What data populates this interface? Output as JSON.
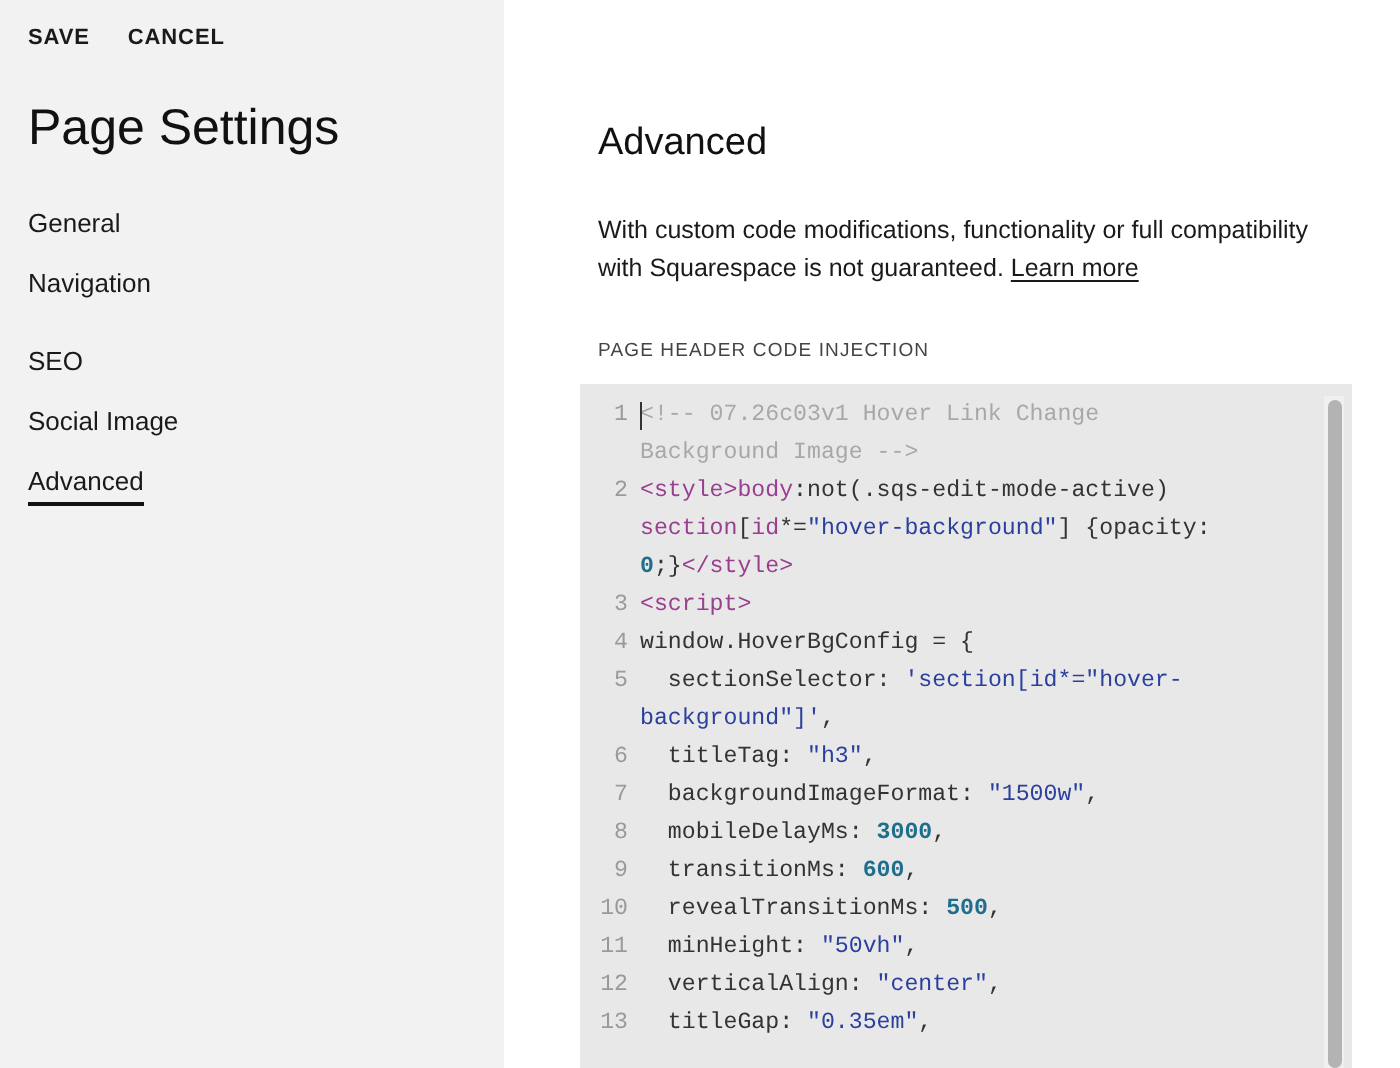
{
  "toolbar": {
    "buttons": [
      "SAVE",
      "CANCEL"
    ]
  },
  "sidebar": {
    "title": "Page Settings",
    "groups": [
      {
        "items": [
          {
            "label": "General",
            "selected": false
          },
          {
            "label": "Navigation",
            "selected": false
          }
        ]
      },
      {
        "items": [
          {
            "label": "SEO",
            "selected": false
          },
          {
            "label": "Social Image",
            "selected": false
          },
          {
            "label": "Advanced",
            "selected": true
          }
        ]
      }
    ]
  },
  "main": {
    "heading": "Advanced",
    "description": "With custom code modifications, functionality or full compatibility with Squarespace is not guaranteed.",
    "link": "Learn more",
    "section_label": "PAGE HEADER CODE INJECTION",
    "code_cursor": true,
    "code_lines": [
      {
        "number": "1",
        "rows": [
          {
            "tokens": [
              {
                "kind": "comment",
                "text": "<!-- 07.26c03v1 Hover Link Change"
              }
            ]
          },
          {
            "tokens": [
              {
                "kind": "comment",
                "text": "Background Image -->"
              }
            ]
          }
        ]
      },
      {
        "number": "2",
        "rows": [
          {
            "tokens": [
              {
                "kind": "tag",
                "text": "<style>"
              },
              {
                "kind": "tag",
                "text": "body"
              },
              {
                "kind": "plain",
                "text": ":not(.sqs-edit-mode-active)"
              }
            ]
          },
          {
            "tokens": [
              {
                "kind": "tag",
                "text": "section"
              },
              {
                "kind": "plain",
                "text": "["
              },
              {
                "kind": "tag",
                "text": "id"
              },
              {
                "kind": "plain",
                "text": "*="
              },
              {
                "kind": "string",
                "text": "\"hover-background\""
              },
              {
                "kind": "plain",
                "text": "] {opacity:"
              }
            ]
          },
          {
            "tokens": [
              {
                "kind": "number",
                "text": "0"
              },
              {
                "kind": "plain",
                "text": ";}"
              },
              {
                "kind": "tag",
                "text": "</style>"
              }
            ]
          }
        ]
      },
      {
        "number": "3",
        "rows": [
          {
            "tokens": [
              {
                "kind": "tag",
                "text": "<script>"
              }
            ]
          }
        ]
      },
      {
        "number": "4",
        "rows": [
          {
            "tokens": [
              {
                "kind": "plain",
                "text": "window.HoverBgConfig = {"
              }
            ]
          }
        ]
      },
      {
        "number": "5",
        "rows": [
          {
            "tokens": [
              {
                "kind": "plain",
                "text": "  sectionSelector: "
              },
              {
                "kind": "string",
                "text": "'section[id*=\"hover-"
              }
            ]
          },
          {
            "tokens": [
              {
                "kind": "string",
                "text": "background\"]'"
              },
              {
                "kind": "plain",
                "text": ","
              }
            ]
          }
        ]
      },
      {
        "number": "6",
        "rows": [
          {
            "tokens": [
              {
                "kind": "plain",
                "text": "  titleTag: "
              },
              {
                "kind": "string",
                "text": "\"h3\""
              },
              {
                "kind": "plain",
                "text": ","
              }
            ]
          }
        ]
      },
      {
        "number": "7",
        "rows": [
          {
            "tokens": [
              {
                "kind": "plain",
                "text": "  backgroundImageFormat: "
              },
              {
                "kind": "string",
                "text": "\"1500w\""
              },
              {
                "kind": "plain",
                "text": ","
              }
            ]
          }
        ]
      },
      {
        "number": "8",
        "rows": [
          {
            "tokens": [
              {
                "kind": "plain",
                "text": "  mobileDelayMs: "
              },
              {
                "kind": "number",
                "text": "3000"
              },
              {
                "kind": "plain",
                "text": ","
              }
            ]
          }
        ]
      },
      {
        "number": "9",
        "rows": [
          {
            "tokens": [
              {
                "kind": "plain",
                "text": "  transitionMs: "
              },
              {
                "kind": "number",
                "text": "600"
              },
              {
                "kind": "plain",
                "text": ","
              }
            ]
          }
        ]
      },
      {
        "number": "10",
        "rows": [
          {
            "tokens": [
              {
                "kind": "plain",
                "text": "  revealTransitionMs: "
              },
              {
                "kind": "number",
                "text": "500"
              },
              {
                "kind": "plain",
                "text": ","
              }
            ]
          }
        ]
      },
      {
        "number": "11",
        "rows": [
          {
            "tokens": [
              {
                "kind": "plain",
                "text": "  minHeight: "
              },
              {
                "kind": "string",
                "text": "\"50vh\""
              },
              {
                "kind": "plain",
                "text": ","
              }
            ]
          }
        ]
      },
      {
        "number": "12",
        "rows": [
          {
            "tokens": [
              {
                "kind": "plain",
                "text": "  verticalAlign: "
              },
              {
                "kind": "string",
                "text": "\"center\""
              },
              {
                "kind": "plain",
                "text": ","
              }
            ]
          }
        ]
      },
      {
        "number": "13",
        "rows": [
          {
            "tokens": [
              {
                "kind": "plain",
                "text": "  titleGap: "
              },
              {
                "kind": "string",
                "text": "\"0.35em\""
              },
              {
                "kind": "plain",
                "text": ","
              }
            ]
          }
        ]
      }
    ]
  }
}
